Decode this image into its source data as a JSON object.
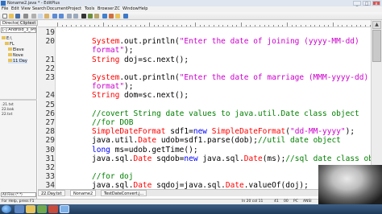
{
  "window": {
    "title": "Noname2.java * - EditPlus",
    "controls": [
      "_",
      "□",
      "x"
    ]
  },
  "menu": {
    "items": [
      "File",
      "Edit",
      "View",
      "Search",
      "Document",
      "Project",
      "Tools",
      "Browser",
      "ZC",
      "Window",
      "Help"
    ]
  },
  "toolbar": {
    "icons": [
      "new-icon",
      "open-icon",
      "save-icon",
      "print-icon",
      "cut-icon",
      "copy-icon",
      "paste-icon",
      "undo-icon",
      "redo-icon",
      "find-icon",
      "replace-icon",
      "font-icon",
      "wordwrap-icon",
      "ruler-icon",
      "browser-icon",
      "cliptext-icon",
      "directory-icon",
      "help-icon"
    ]
  },
  "left_panel": {
    "tabs": [
      "Directory",
      "Cliptext"
    ],
    "drive": "[-] Android_3_iPhone 5",
    "tree": [
      "E:\\",
      "FL",
      "Eleve",
      "Nove",
      "11 Day"
    ],
    "selected_index": 4,
    "files": [
      ".21.txt",
      "22.bak",
      "22.txt"
    ],
    "filter": "All Files (*.*)"
  },
  "editor": {
    "lines": [
      {
        "num": "19",
        "tokens": []
      },
      {
        "num": "20",
        "tokens": [
          {
            "t": "ty",
            "v": "System"
          },
          {
            "t": "p",
            "v": ".out.println("
          },
          {
            "t": "str",
            "v": "\"Enter the date of joining (yyyy-MM-dd)"
          }
        ]
      },
      {
        "num": "",
        "tokens": [
          {
            "t": "str",
            "v": "format\""
          },
          {
            "t": "p",
            "v": ");"
          }
        ]
      },
      {
        "num": "21",
        "tokens": [
          {
            "t": "ty",
            "v": "String"
          },
          {
            "t": "p",
            "v": " doj=sc.next();"
          }
        ]
      },
      {
        "num": "22",
        "tokens": []
      },
      {
        "num": "23",
        "tokens": [
          {
            "t": "ty",
            "v": "System"
          },
          {
            "t": "p",
            "v": ".out.println("
          },
          {
            "t": "str",
            "v": "\"Enter the date of marriage (MMM-yyyy-dd)"
          }
        ]
      },
      {
        "num": "",
        "tokens": [
          {
            "t": "str",
            "v": "format\""
          },
          {
            "t": "p",
            "v": ");"
          }
        ]
      },
      {
        "num": "24",
        "tokens": [
          {
            "t": "ty",
            "v": "String"
          },
          {
            "t": "p",
            "v": " dom=sc.next();"
          }
        ]
      },
      {
        "num": "25",
        "tokens": []
      },
      {
        "num": "26",
        "tokens": [
          {
            "t": "cm",
            "v": "//covert String date values to java.util.Date class object"
          }
        ]
      },
      {
        "num": "27",
        "tokens": [
          {
            "t": "cm",
            "v": "//for DOB"
          }
        ]
      },
      {
        "num": "28",
        "tokens": [
          {
            "t": "ty",
            "v": "SimpleDateFormat"
          },
          {
            "t": "p",
            "v": " sdf1="
          },
          {
            "t": "kw",
            "v": "new"
          },
          {
            "t": "p",
            "v": " "
          },
          {
            "t": "ty",
            "v": "SimpleDateFormat"
          },
          {
            "t": "p",
            "v": "("
          },
          {
            "t": "str",
            "v": "\"dd-MM-yyyy\""
          },
          {
            "t": "p",
            "v": ");"
          }
        ]
      },
      {
        "num": "29",
        "tokens": [
          {
            "t": "p",
            "v": "java.util."
          },
          {
            "t": "ty",
            "v": "Date"
          },
          {
            "t": "p",
            "v": " udob=sdf1.parse(dob);"
          },
          {
            "t": "cm",
            "v": "//util date object"
          }
        ]
      },
      {
        "num": "30",
        "tokens": [
          {
            "t": "kw",
            "v": "long"
          },
          {
            "t": "p",
            "v": " ms=udob.getTime();"
          }
        ]
      },
      {
        "num": "31",
        "tokens": [
          {
            "t": "p",
            "v": "java.sql."
          },
          {
            "t": "ty",
            "v": "Date"
          },
          {
            "t": "p",
            "v": " sqdob="
          },
          {
            "t": "kw",
            "v": "new"
          },
          {
            "t": "p",
            "v": " java.sql."
          },
          {
            "t": "ty",
            "v": "Date"
          },
          {
            "t": "p",
            "v": "(ms);"
          },
          {
            "t": "cm",
            "v": "//sql date class obj"
          }
        ]
      },
      {
        "num": "32",
        "tokens": []
      },
      {
        "num": "33",
        "tokens": [
          {
            "t": "cm",
            "v": "//for doj"
          }
        ]
      },
      {
        "num": "34",
        "tokens": [
          {
            "t": "p",
            "v": "java.sql."
          },
          {
            "t": "ty",
            "v": "Date"
          },
          {
            "t": "p",
            "v": " sqdoj=java.sql."
          },
          {
            "t": "ty",
            "v": "Date"
          },
          {
            "t": "p",
            "v": ".valueOf(doj);"
          }
        ]
      }
    ]
  },
  "doc_tabs": [
    "22.Day.txt",
    "Noname2",
    "TestDateConvert.j..."
  ],
  "active_doc_tab": 1,
  "status": {
    "help": "For Help, press F1",
    "position": "In 20  col 11",
    "lines": "41",
    "mode": "00",
    "eol": "PC",
    "encoding": "ANSI"
  },
  "colors": {
    "keyword": "#0000ff",
    "string": "#cc00cc",
    "type": "#ff0000",
    "comment": "#008000",
    "taskbar": "#1f3a5a"
  }
}
